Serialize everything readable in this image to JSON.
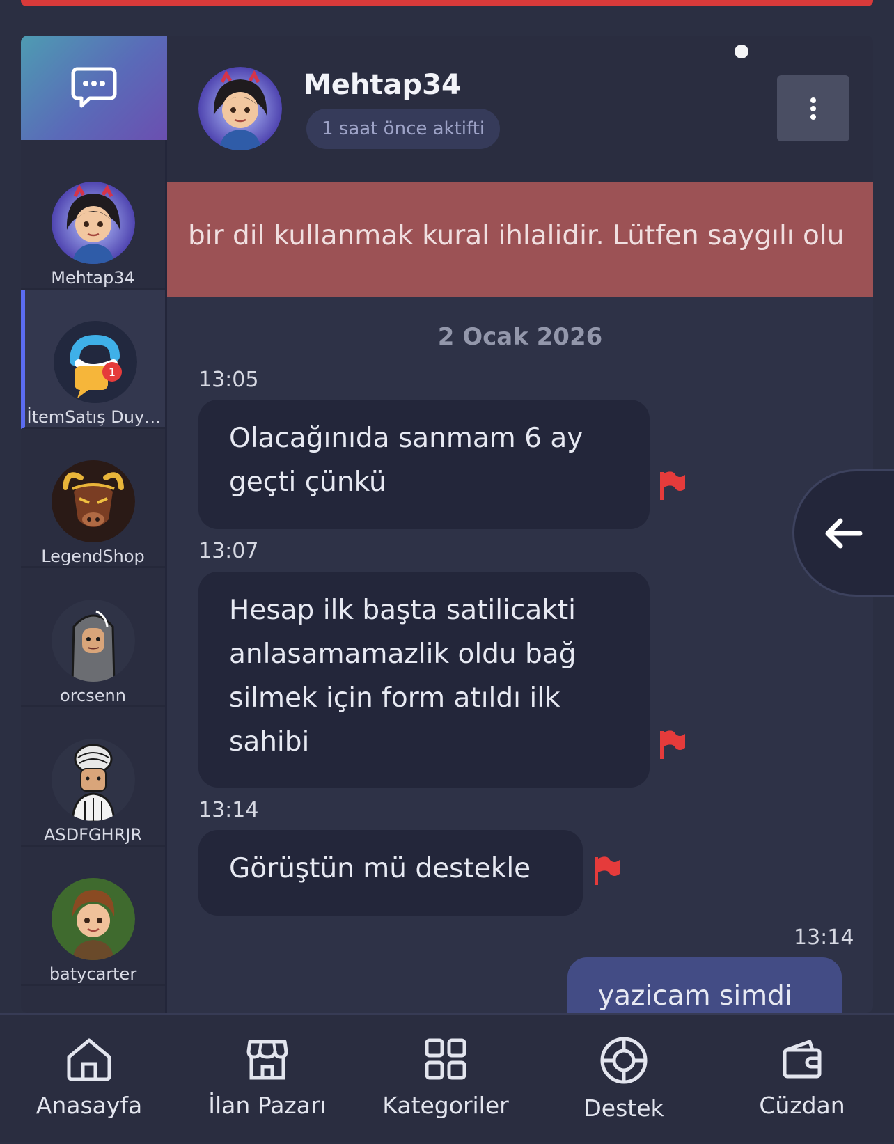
{
  "colors": {
    "accent": "#5b6cf0",
    "alert_bar": "#d83a3a",
    "warning_banner": "#9c5255",
    "flag": "#e53b3b",
    "own_bubble": "#434c85"
  },
  "sidebar": {
    "chat_icon": "chat-bubble-icon",
    "contacts": [
      {
        "name": "Mehtap34",
        "active": false
      },
      {
        "name": "İtemSatış Duyu...",
        "active": true,
        "badge": "1"
      },
      {
        "name": "LegendShop",
        "active": false
      },
      {
        "name": "orcsenn",
        "active": false
      },
      {
        "name": "ASDFGHRJR",
        "active": false
      },
      {
        "name": "batycarter",
        "active": false
      }
    ]
  },
  "header": {
    "name": "Mehtap34",
    "status": "1 saat önce aktifti",
    "menu_icon": "more-vertical-icon"
  },
  "warning": {
    "text": "bir dil kullanmak kural ihlalidir. Lütfen saygılı olu"
  },
  "chat": {
    "date": "2 Ocak 2026",
    "messages": [
      {
        "time": "13:05",
        "text": "Olacağınıda sanmam 6 ay geçti çünkü",
        "mine": false
      },
      {
        "time": "13:07",
        "text": "Hesap ilk başta satilicakti anlasamamazlik oldu bağ silmek için form atıldı ilk sahibi",
        "mine": false
      },
      {
        "time": "13:14",
        "text": "Görüştün mü destekle",
        "mine": false
      },
      {
        "time": "13:14",
        "text": "yazicam simdi",
        "mine": true
      }
    ]
  },
  "back_icon": "arrow-left-icon",
  "nav": {
    "items": [
      {
        "label": "Anasayfa",
        "icon": "home-icon"
      },
      {
        "label": "İlan Pazarı",
        "icon": "store-icon"
      },
      {
        "label": "Kategoriler",
        "icon": "grid-icon"
      },
      {
        "label": "Destek",
        "icon": "lifebuoy-icon"
      },
      {
        "label": "Cüzdan",
        "icon": "wallet-icon"
      }
    ]
  }
}
